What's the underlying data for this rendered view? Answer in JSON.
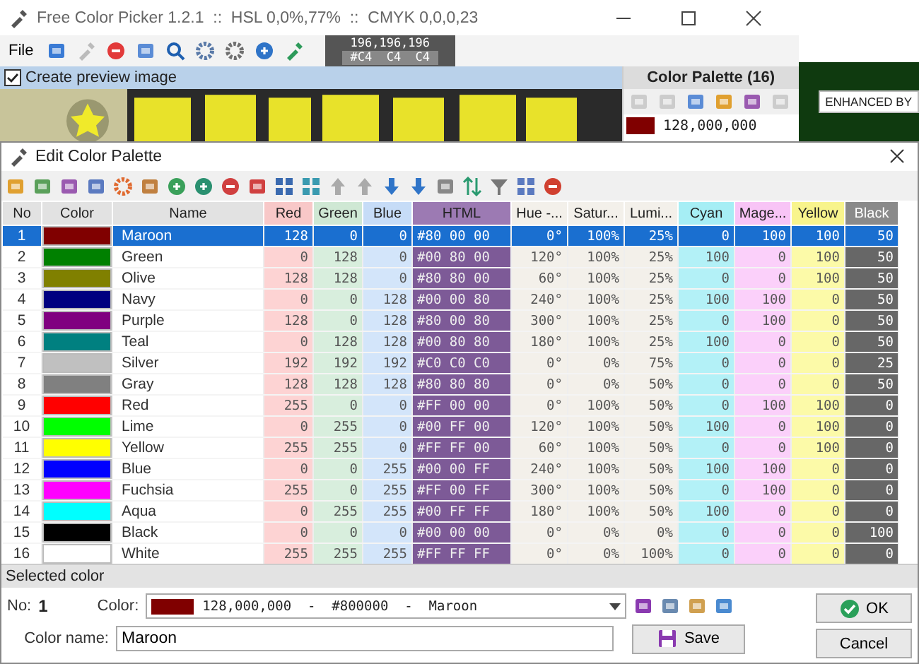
{
  "main_window": {
    "title": "Free Color Picker 1.2.1  ::  HSL 0,0%,77%  ::  CMYK 0,0,0,23",
    "menu": [
      "File"
    ],
    "readout": {
      "rgb": "196,196,196",
      "hex": "#C4  C4  C4"
    },
    "preview": {
      "label": "Create preview image",
      "checked": true
    },
    "palette_panel": {
      "title": "Color Palette (16)",
      "entries": [
        {
          "value": "128,000,000",
          "color": "#800000"
        }
      ]
    }
  },
  "background_page": {
    "button": "ENHANCED BY"
  },
  "dialog": {
    "title": "Edit Color Palette",
    "table": {
      "columns": [
        "No",
        "Color",
        "Name",
        "Red",
        "Green",
        "Blue",
        "HTML",
        "Hue -...",
        "Satur...",
        "Lumi...",
        "Cyan",
        "Mage...",
        "Yellow",
        "Black"
      ],
      "rows": [
        {
          "no": "1",
          "color": "#800000",
          "name": "Maroon",
          "red": "128",
          "green": "0",
          "blue": "0",
          "html": "#80 00 00",
          "hue": "0°",
          "saturation": "100%",
          "luminance": "25%",
          "cyan": "0",
          "magenta": "100",
          "yellow": "100",
          "black": "50",
          "selected": true
        },
        {
          "no": "2",
          "color": "#008000",
          "name": "Green",
          "red": "0",
          "green": "128",
          "blue": "0",
          "html": "#00 80 00",
          "hue": "120°",
          "saturation": "100%",
          "luminance": "25%",
          "cyan": "100",
          "magenta": "0",
          "yellow": "100",
          "black": "50",
          "selected": false
        },
        {
          "no": "3",
          "color": "#808000",
          "name": "Olive",
          "red": "128",
          "green": "128",
          "blue": "0",
          "html": "#80 80 00",
          "hue": "60°",
          "saturation": "100%",
          "luminance": "25%",
          "cyan": "0",
          "magenta": "0",
          "yellow": "100",
          "black": "50",
          "selected": false
        },
        {
          "no": "4",
          "color": "#000080",
          "name": "Navy",
          "red": "0",
          "green": "0",
          "blue": "128",
          "html": "#00 00 80",
          "hue": "240°",
          "saturation": "100%",
          "luminance": "25%",
          "cyan": "100",
          "magenta": "100",
          "yellow": "0",
          "black": "50",
          "selected": false
        },
        {
          "no": "5",
          "color": "#800080",
          "name": "Purple",
          "red": "128",
          "green": "0",
          "blue": "128",
          "html": "#80 00 80",
          "hue": "300°",
          "saturation": "100%",
          "luminance": "25%",
          "cyan": "0",
          "magenta": "100",
          "yellow": "0",
          "black": "50",
          "selected": false
        },
        {
          "no": "6",
          "color": "#008080",
          "name": "Teal",
          "red": "0",
          "green": "128",
          "blue": "128",
          "html": "#00 80 80",
          "hue": "180°",
          "saturation": "100%",
          "luminance": "25%",
          "cyan": "100",
          "magenta": "0",
          "yellow": "0",
          "black": "50",
          "selected": false
        },
        {
          "no": "7",
          "color": "#c0c0c0",
          "name": "Silver",
          "red": "192",
          "green": "192",
          "blue": "192",
          "html": "#C0 C0 C0",
          "hue": "0°",
          "saturation": "0%",
          "luminance": "75%",
          "cyan": "0",
          "magenta": "0",
          "yellow": "0",
          "black": "25",
          "selected": false
        },
        {
          "no": "8",
          "color": "#808080",
          "name": "Gray",
          "red": "128",
          "green": "128",
          "blue": "128",
          "html": "#80 80 80",
          "hue": "0°",
          "saturation": "0%",
          "luminance": "50%",
          "cyan": "0",
          "magenta": "0",
          "yellow": "0",
          "black": "50",
          "selected": false
        },
        {
          "no": "9",
          "color": "#ff0000",
          "name": "Red",
          "red": "255",
          "green": "0",
          "blue": "0",
          "html": "#FF 00 00",
          "hue": "0°",
          "saturation": "100%",
          "luminance": "50%",
          "cyan": "0",
          "magenta": "100",
          "yellow": "100",
          "black": "0",
          "selected": false
        },
        {
          "no": "10",
          "color": "#00ff00",
          "name": "Lime",
          "red": "0",
          "green": "255",
          "blue": "0",
          "html": "#00 FF 00",
          "hue": "120°",
          "saturation": "100%",
          "luminance": "50%",
          "cyan": "100",
          "magenta": "0",
          "yellow": "100",
          "black": "0",
          "selected": false
        },
        {
          "no": "11",
          "color": "#ffff00",
          "name": "Yellow",
          "red": "255",
          "green": "255",
          "blue": "0",
          "html": "#FF FF 00",
          "hue": "60°",
          "saturation": "100%",
          "luminance": "50%",
          "cyan": "0",
          "magenta": "0",
          "yellow": "100",
          "black": "0",
          "selected": false
        },
        {
          "no": "12",
          "color": "#0000ff",
          "name": "Blue",
          "red": "0",
          "green": "0",
          "blue": "255",
          "html": "#00 00 FF",
          "hue": "240°",
          "saturation": "100%",
          "luminance": "50%",
          "cyan": "100",
          "magenta": "100",
          "yellow": "0",
          "black": "0",
          "selected": false
        },
        {
          "no": "13",
          "color": "#ff00ff",
          "name": "Fuchsia",
          "red": "255",
          "green": "0",
          "blue": "255",
          "html": "#FF 00 FF",
          "hue": "300°",
          "saturation": "100%",
          "luminance": "50%",
          "cyan": "0",
          "magenta": "100",
          "yellow": "0",
          "black": "0",
          "selected": false
        },
        {
          "no": "14",
          "color": "#00ffff",
          "name": "Aqua",
          "red": "0",
          "green": "255",
          "blue": "255",
          "html": "#00 FF FF",
          "hue": "180°",
          "saturation": "100%",
          "luminance": "50%",
          "cyan": "100",
          "magenta": "0",
          "yellow": "0",
          "black": "0",
          "selected": false
        },
        {
          "no": "15",
          "color": "#000000",
          "name": "Black",
          "red": "0",
          "green": "0",
          "blue": "0",
          "html": "#00 00 00",
          "hue": "0°",
          "saturation": "0%",
          "luminance": "0%",
          "cyan": "0",
          "magenta": "0",
          "yellow": "0",
          "black": "100",
          "selected": false
        },
        {
          "no": "16",
          "color": "#ffffff",
          "name": "White",
          "red": "255",
          "green": "255",
          "blue": "255",
          "html": "#FF FF FF",
          "hue": "0°",
          "saturation": "0%",
          "luminance": "100%",
          "cyan": "0",
          "magenta": "0",
          "yellow": "0",
          "black": "0",
          "selected": false
        }
      ]
    },
    "section_label": "Selected color",
    "no_field": {
      "label": "No:",
      "value": "1"
    },
    "color_field": {
      "label": "Color:",
      "value": "128,000,000  -  #800000  -  Maroon",
      "color": "#800000"
    },
    "name_field": {
      "label": "Color name:",
      "value": "Maroon"
    },
    "buttons": {
      "ok": "OK",
      "save": "Save",
      "cancel": "Cancel"
    }
  }
}
